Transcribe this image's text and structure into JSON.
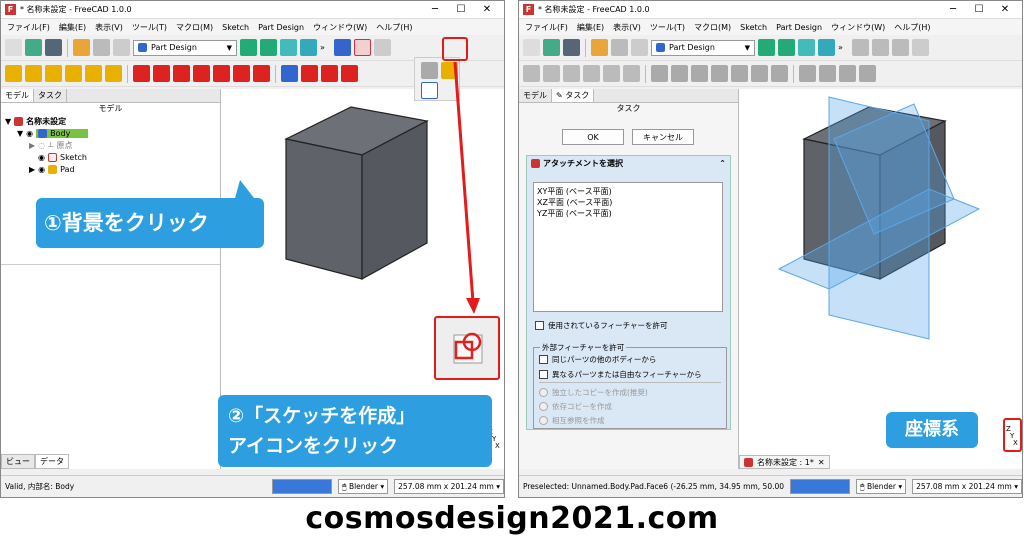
{
  "window_title": "* 名称未設定 - FreeCAD 1.0.0",
  "menu": [
    "ファイル(F)",
    "編集(E)",
    "表示(V)",
    "ツール(T)",
    "マクロ(M)",
    "Sketch",
    "Part Design",
    "ウィンドウ(W)",
    "ヘルプ(H)"
  ],
  "workbench": "Part Design",
  "overflow": "»",
  "left": {
    "tabs": [
      "モデル",
      "タスク"
    ],
    "panel_title": "モデル",
    "tree": [
      "名称未設定",
      "Body",
      "原点",
      "Sketch",
      "Pad"
    ],
    "bottom_tabs": [
      "ビュー",
      "データ"
    ],
    "status": "Valid, 内部名: Body",
    "nav_style": "Blender",
    "dimensions": "257.08 mm x 201.24 mm"
  },
  "right": {
    "tabs": [
      "モデル",
      "タスク"
    ],
    "panel_title": "タスク",
    "ok": "OK",
    "cancel": "キャンセル",
    "attach_title": "アタッチメントを選択",
    "planes": [
      "XY平面 (ベース平面)",
      "XZ平面 (ベース平面)",
      "YZ平面 (ベース平面)"
    ],
    "allow_used": "使用されているフィーチャーを許可",
    "external_group": "外部フィーチャーを許可",
    "ext1": "同じパーツの他のボディーから",
    "ext2": "異なるパーツまたは自由なフィーチャーから",
    "r1": "独立したコピーを作成(推奨)",
    "r2": "依存コピーを作成",
    "r3": "相互参照を作成",
    "doc_tab": "名称未設定 : 1*",
    "status": "Preselected: Unnamed.Body.Pad.Face6 (-26.25 mm, 34.95 mm, 50.00 mm)",
    "nav_style": "Blender",
    "dimensions": "257.08 mm x 201.24 mm"
  },
  "callouts": {
    "c1": "①背景をクリック",
    "c2a": "②「スケッチを作成」",
    "c2b": "アイコンをクリック",
    "c3": "座標系"
  },
  "axis_label": {
    "z": "Z",
    "y": "Y",
    "x": "X"
  },
  "footer": "cosmosdesign2021.com",
  "colors": {
    "callout": "#2d9fe0",
    "highlight": "#e21b1b",
    "cube": "#5f6268",
    "plane": "#5aa7e8",
    "selected": "#7bc142"
  }
}
